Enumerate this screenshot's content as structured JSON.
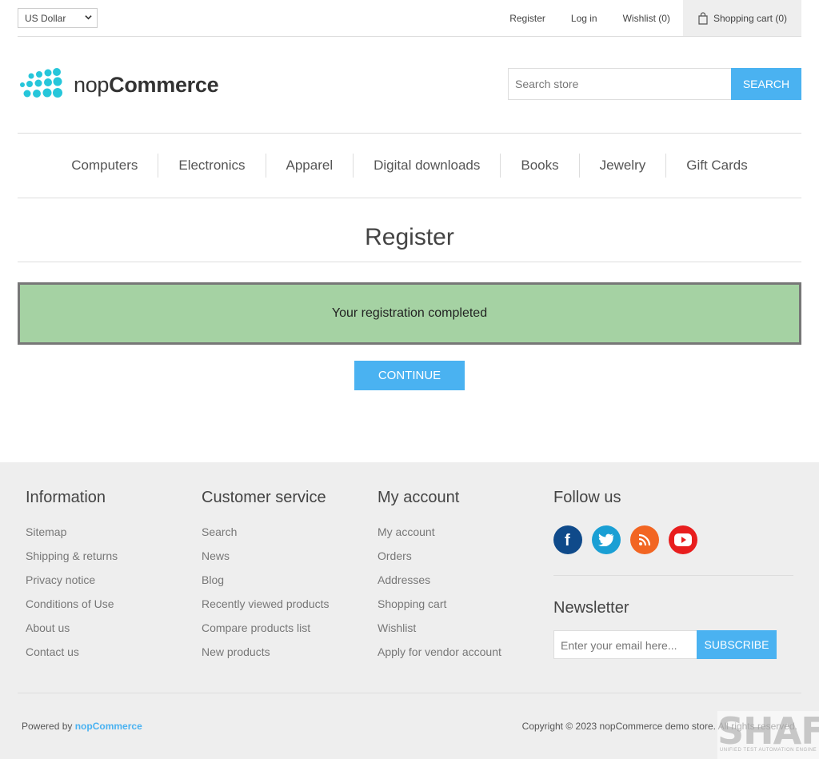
{
  "header": {
    "currency": "US Dollar",
    "links": {
      "register": "Register",
      "login": "Log in",
      "wishlist": "Wishlist (0)",
      "cart": "Shopping cart (0)"
    },
    "logo": {
      "light": "nop",
      "bold": "Commerce"
    },
    "search": {
      "placeholder": "Search store",
      "button": "SEARCH"
    }
  },
  "menu": [
    "Computers",
    "Electronics",
    "Apparel",
    "Digital downloads",
    "Books",
    "Jewelry",
    "Gift Cards"
  ],
  "page": {
    "title": "Register",
    "result": "Your registration completed",
    "continue": "CONTINUE"
  },
  "footer": {
    "information": {
      "title": "Information",
      "links": [
        "Sitemap",
        "Shipping & returns",
        "Privacy notice",
        "Conditions of Use",
        "About us",
        "Contact us"
      ]
    },
    "customer_service": {
      "title": "Customer service",
      "links": [
        "Search",
        "News",
        "Blog",
        "Recently viewed products",
        "Compare products list",
        "New products"
      ]
    },
    "my_account": {
      "title": "My account",
      "links": [
        "My account",
        "Orders",
        "Addresses",
        "Shopping cart",
        "Wishlist",
        "Apply for vendor account"
      ]
    },
    "follow_us": {
      "title": "Follow us",
      "icons": [
        "facebook-icon",
        "twitter-icon",
        "rss-icon",
        "youtube-icon"
      ]
    },
    "newsletter": {
      "title": "Newsletter",
      "placeholder": "Enter your email here...",
      "button": "SUBSCRIBE"
    },
    "powered_prefix": "Powered by",
    "powered_link": "nopCommerce",
    "copyright": "Copyright © 2023 nopCommerce demo store. All rights reserved."
  },
  "watermark": {
    "big": "SHAFT",
    "small": "UNIFIED TEST AUTOMATION ENGINE"
  },
  "colors": {
    "accent": "#4ab2f1",
    "success_bg": "#a5d2a3",
    "footer_bg": "#eeeeee",
    "logo_dots": "#26c6da"
  }
}
